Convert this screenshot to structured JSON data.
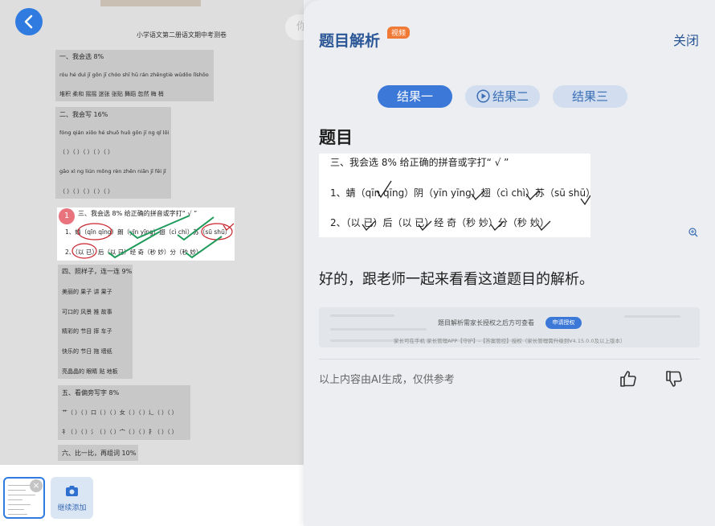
{
  "worksheet": {
    "title": "小学语文第二册语文期中考测卷",
    "sections": [
      {
        "heading": "一、我会选 8%",
        "lines": [
          "róu hé duì jī gǒn jī chóo shī hū rán zhēngtiè wūdōo lǐshōo",
          "堆积 柔和 摇摇 迷张 张贴 舞蹈 忽然 梅 梢"
        ]
      },
      {
        "heading": "二、我会写 16%",
        "lines": [
          "fóng qián xiōo hé shuō huō gōn jī ng qǐ lōi",
          "（ ）（ ）（ ）（ ）（ ）",
          "gāo xì ng liún mōng rèn zhēn niān jī fēi jī",
          "（ ）（ ）（ ）（ ）（ ）"
        ]
      },
      {
        "heading": "四、照样子，连一连 9%",
        "lines": [
          "美丽的 果子  讲 果子",
          "可口的 风景  推 故事",
          "精彩的 节目  摔 车子",
          "快乐的 节日  拖 墙纸",
          "亮晶晶的 眼睛 贴 地板"
        ]
      },
      {
        "heading": "五、看偏旁写字 8%",
        "lines": [
          "艹（ ）（ ）口（ ）（ ）女（ ）（ ）辶（ ）（ ）",
          "礻（ ）（ ）氵（ ）（ ）宀（ ）（ ）扌（ ）（ ）"
        ]
      },
      {
        "heading": "六、比一比，再组词 10%",
        "lines": []
      }
    ],
    "highlight": {
      "badge": "1",
      "heading": "三、我会选 8% 给正确的拼音或字打“ √ ”",
      "line1": "1、蜻（qīn qīng）朗（yīn yīng）翅（cì chì）苏（sū shū）",
      "line2": "2、（以 已）后（以 已）经 奇（秒 妙）分（秒 妙）"
    }
  },
  "thumbnail_bar": {
    "close_glyph": "×",
    "add_label": "继续添加"
  },
  "side_pill": "你",
  "panel": {
    "title": "题目解析",
    "badge": "视频",
    "close_label": "关闭",
    "tabs": [
      {
        "label": "结果一",
        "active": true,
        "icon": ""
      },
      {
        "label": "结果二",
        "active": false,
        "icon": "play-circle-icon"
      },
      {
        "label": "结果三",
        "active": false,
        "icon": ""
      }
    ],
    "question_heading": "题目",
    "question_image": {
      "line0": "三、我会选 8% 给正确的拼音或字打“ √ ”",
      "line1": "1、蜻（qīn qīng）阴（yīn yīng）翅（cì chì）苏（sū shū）",
      "line2": "2、（以 已）后（以 已）经 奇（秒 妙）分（秒 妙）"
    },
    "answer_intro": "好的，跟老师一起来看看这道题目的解析。",
    "locked": {
      "message": "题目解析需家长授权之后方可查看",
      "button": "申请授权",
      "note": "家长可在手机 家长管理APP【守护】-【答案管控】授权（家长管理需升级到V4.15.0.0及以上版本）"
    },
    "ai_note": "以上内容由AI生成，仅供参考",
    "colors": {
      "accent": "#3b78d8",
      "title": "#2b5797",
      "badge": "#f07a35"
    }
  }
}
